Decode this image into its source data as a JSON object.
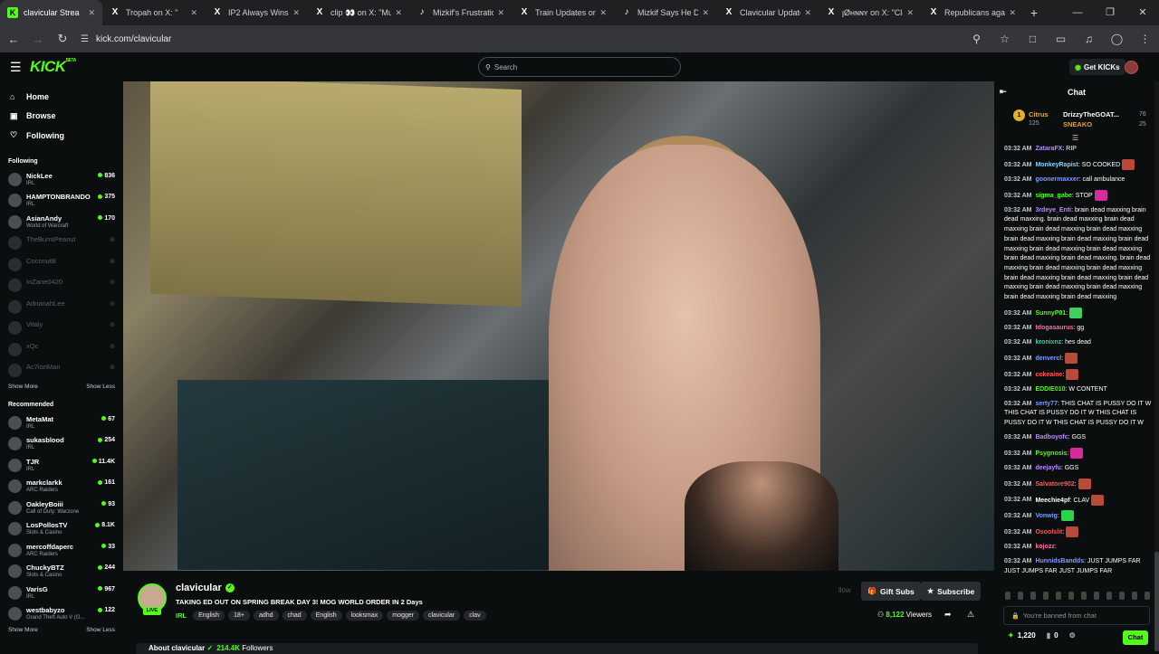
{
  "browser": {
    "tabs": [
      {
        "title": "clavicular Strea",
        "icon": "kick-icon",
        "active": true
      },
      {
        "title": "Tropah on X: \"",
        "icon": "x-icon"
      },
      {
        "title": "IP2 Always Wins o",
        "icon": "x-icon"
      },
      {
        "title": "clip 👀 on X: \"Mu",
        "icon": "x-icon"
      },
      {
        "title": "Mizkif's Frustratio",
        "icon": "tiktok-icon"
      },
      {
        "title": "Train Updates on",
        "icon": "x-icon"
      },
      {
        "title": "Mizkif Says He Do",
        "icon": "tiktok-icon"
      },
      {
        "title": "Clavicular Update",
        "icon": "x-icon"
      },
      {
        "title": "ȷØʜɴɴʏ on X: \"Cla",
        "icon": "x-icon"
      },
      {
        "title": "Republicans agai",
        "icon": "x-icon"
      }
    ],
    "url": "kick.com/clavicular"
  },
  "header": {
    "logo": "KICK",
    "logo_badge": "BETA",
    "search_placeholder": "Search",
    "get_kicks": "Get KICKs"
  },
  "sidebar": {
    "nav": [
      {
        "label": "Home",
        "icon": "home-icon"
      },
      {
        "label": "Browse",
        "icon": "browse-icon"
      },
      {
        "label": "Following",
        "icon": "heart-icon"
      }
    ],
    "following_title": "Following",
    "following": [
      {
        "name": "NickLee",
        "category": "IRL",
        "viewers": "836",
        "live": true
      },
      {
        "name": "HAMPTONBRANDO",
        "category": "IRL",
        "viewers": "375",
        "live": true
      },
      {
        "name": "AsianAndy",
        "category": "World of Warcraft",
        "viewers": "170",
        "live": true
      },
      {
        "name": "TheBurntPeanut",
        "live": false
      },
      {
        "name": "CoconutB",
        "live": false
      },
      {
        "name": "InZane0420",
        "live": false
      },
      {
        "name": "AdrianahLee",
        "live": false
      },
      {
        "name": "Vitaly",
        "live": false
      },
      {
        "name": "xQc",
        "live": false
      },
      {
        "name": "Ac7ionMan",
        "live": false
      }
    ],
    "show_more": "Show More",
    "show_less": "Show Less",
    "recommended_title": "Recommended",
    "recommended": [
      {
        "name": "MetaMat",
        "category": "IRL",
        "viewers": "67"
      },
      {
        "name": "sukasblood",
        "category": "IRL",
        "viewers": "254"
      },
      {
        "name": "TJR",
        "category": "IRL",
        "viewers": "11.4K"
      },
      {
        "name": "markclarkk",
        "category": "ARC Raiders",
        "viewers": "161"
      },
      {
        "name": "OakleyBoiii",
        "category": "Call of Duty: Warzone",
        "viewers": "93"
      },
      {
        "name": "LosPollosTV",
        "category": "Slots & Casino",
        "viewers": "8.1K"
      },
      {
        "name": "mercoffdaperc",
        "category": "ARC Raiders",
        "viewers": "33"
      },
      {
        "name": "ChuckyBTZ",
        "category": "Slots & Casino",
        "viewers": "244"
      },
      {
        "name": "VarisG",
        "category": "IRL",
        "viewers": "967"
      },
      {
        "name": "westbabyzo",
        "category": "Grand Theft Auto V (G...",
        "viewers": "122"
      }
    ]
  },
  "stream": {
    "channel": "clavicular",
    "live_badge": "LIVE",
    "title": "TAKING ED OUT ON SPRING BREAK DAY 3! MOG WORLD ORDER IN 2 Days",
    "category": "IRL",
    "tags": [
      "English",
      "18+",
      "adhd",
      "chad",
      "English",
      "looksmax",
      "mogger",
      "clavicular",
      "clav"
    ],
    "follow_label": "llow",
    "gift_subs": "Gift Subs",
    "subscribe": "Subscribe",
    "viewers": "8,122",
    "viewers_label": "Viewers",
    "about_label": "About clavicular",
    "followers": "214.4K",
    "followers_label": "Followers"
  },
  "chat": {
    "title": "Chat",
    "gifters": [
      {
        "name": "Citrus",
        "count": "125",
        "color": "#e0b02a"
      },
      {
        "name": "DrizzyTheGOAT...",
        "count": "76",
        "color": "#ffffff"
      },
      {
        "name": "SNEAKO",
        "count": "25",
        "color": "#f49b23"
      }
    ],
    "messages": [
      {
        "time": "03:32 AM",
        "user": "ZataraFX",
        "color": "#b48cff",
        "text": "RIP"
      },
      {
        "time": "03:32 AM",
        "user": "MonkeyRapist",
        "color": "#7dd4ff",
        "text": "SO COOKED",
        "emote": "em-r"
      },
      {
        "time": "03:32 AM",
        "user": "goonermaxxer",
        "color": "#7d9cff",
        "text": "call ambulance"
      },
      {
        "time": "03:32 AM",
        "user": "sigma_gabe",
        "color": "#53fc18",
        "text": "STOP",
        "emote": "em-p"
      },
      {
        "time": "03:32 AM",
        "user": "3rdeye_Enti",
        "color": "#b48cff",
        "text": "brain dead maxxing brain dead maxxing. brain dead maxxing brain dead maxxing brain dead maxxing brain dead maxxing brain dead maxxing brain dead maxxing brain dead maxxing brain dead maxxing brain dead maxxing brain dead maxxing brain dead maxxing. brain dead maxxing brain dead maxxing brain dead maxxing brain dead maxxing brain dead maxxing brain dead maxxing brain dead maxxing brain dead maxxing brain dead maxxing brain dead maxxing"
      },
      {
        "time": "03:32 AM",
        "user": "SunnyP01",
        "color": "#53fc18",
        "text": "",
        "emote": "em-g"
      },
      {
        "time": "03:32 AM",
        "user": "tdogasaurus",
        "color": "#ff6fa8",
        "text": "gg"
      },
      {
        "time": "03:32 AM",
        "user": "kronixnz",
        "color": "#2dd2a8",
        "text": "hes dead"
      },
      {
        "time": "03:32 AM",
        "user": "denvercl",
        "color": "#7d9cff",
        "text": "",
        "emote": "em-r"
      },
      {
        "time": "03:32 AM",
        "user": "cokeaine",
        "color": "#ff5a5a",
        "text": "",
        "emote": "em-r"
      },
      {
        "time": "03:32 AM",
        "user": "EDDIE010",
        "color": "#53fc18",
        "text": "W CONTENT"
      },
      {
        "time": "03:32 AM",
        "user": "serty77",
        "color": "#7d9cff",
        "text": "THIS CHAT IS PUSSY DO IT W THIS CHAT IS PUSSY DO IT W THIS CHAT IS PUSSY DO IT W THIS CHAT IS PUSSY DO IT W"
      },
      {
        "time": "03:32 AM",
        "user": "Badboyofc",
        "color": "#b48cff",
        "text": "GGS"
      },
      {
        "time": "03:32 AM",
        "user": "Psygnosis",
        "color": "#53fc18",
        "text": "",
        "emote": "em-p"
      },
      {
        "time": "03:32 AM",
        "user": "deejayfu",
        "color": "#b48cff",
        "text": "GGS"
      },
      {
        "time": "03:32 AM",
        "user": "Salvatore902",
        "color": "#ff5a5a",
        "text": "",
        "emote": "em-r"
      },
      {
        "time": "03:32 AM",
        "user": "Meechie4pf",
        "color": "#ffffff",
        "text": "CLAV",
        "emote": "em-r"
      },
      {
        "time": "03:32 AM",
        "user": "Vonwig",
        "color": "#7d9cff",
        "text": "",
        "emote": "em-w"
      },
      {
        "time": "03:32 AM",
        "user": "Osoolslit",
        "color": "#ff5a5a",
        "text": "",
        "emote": "em-r"
      },
      {
        "time": "03:32 AM",
        "user": "kojozz",
        "color": "#ff6fa8",
        "text": ""
      },
      {
        "time": "03:32 AM",
        "user": "HunnidsBandds",
        "color": "#7d9cff",
        "text": "JUST JUMPS FAR JUST JUMPS FAR JUST JUMPS FAR"
      }
    ],
    "banned_text": "You're banned from chat",
    "points": "1,220",
    "zero": "0",
    "chat_button": "Chat"
  }
}
